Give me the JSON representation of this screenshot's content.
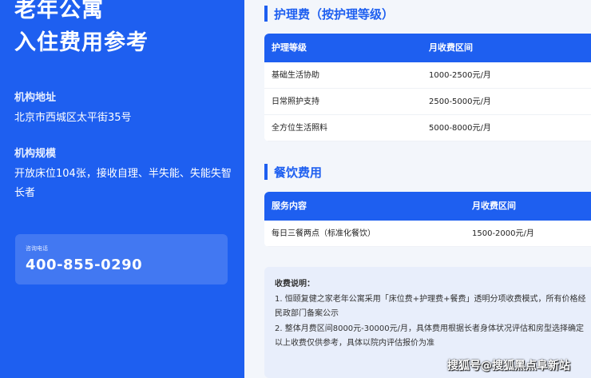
{
  "left": {
    "title_line1": "老年公寓",
    "title_line2": "入住费用参考",
    "address_label": "机构地址",
    "address": "北京市西城区太平街35号",
    "scale_label": "机构规模",
    "scale": "开放床位104张，接收自理、半失能、失能失智长者",
    "phone_label": "咨询电话",
    "phone": "400-855-0290"
  },
  "nursing": {
    "title": "护理费（按护理等级）",
    "headers": [
      "护理等级",
      "月收费区间"
    ],
    "rows": [
      [
        "基础生活协助",
        "1000-2500元/月"
      ],
      [
        "日常照护支持",
        "2500-5000元/月"
      ],
      [
        "全方位生活照料",
        "5000-8000元/月"
      ]
    ]
  },
  "dining": {
    "title": "餐饮费用",
    "headers": [
      "服务内容",
      "月收费区间"
    ],
    "rows": [
      [
        "每日三餐两点（标准化餐饮）",
        "1500-2000元/月"
      ]
    ]
  },
  "notes": {
    "title": "收费说明：",
    "line1": "1. 恒颐复健之家老年公寓采用「床位费+护理费+餐费」透明分项收费模式，所有价格经民政部门备案公示",
    "line2": "2. 整体月费区间8000元-30000元/月，具体费用根据长者身体状况评估和房型选择确定",
    "line3": "以上收费仅供参考，具体以院内评估报价为准"
  },
  "watermark": "搜狐号@搜狐黑点阜新站",
  "colors": {
    "primary": "#1e5ff0",
    "note_bg": "#e8eefb"
  }
}
